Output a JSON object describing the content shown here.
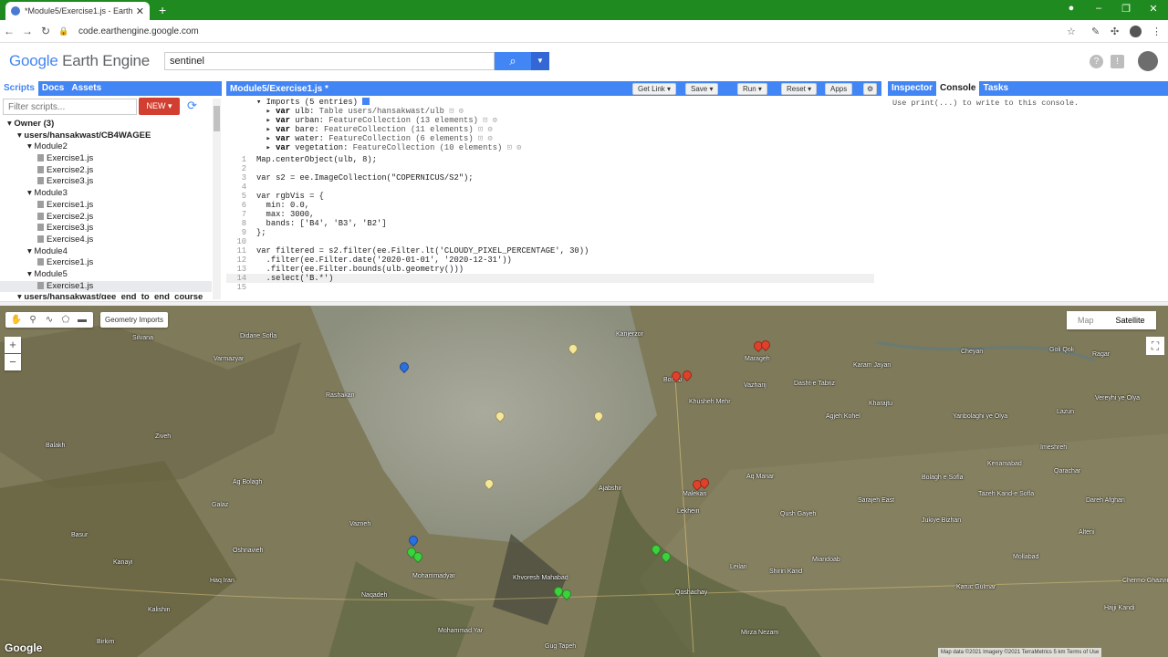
{
  "browser": {
    "tab_title": "*Module5/Exercise1.js - Earth Engi",
    "url": "code.earthengine.google.com"
  },
  "header": {
    "logo_google": "Google",
    "logo_product": "Earth Engine",
    "search_value": "sentinel"
  },
  "left_panel": {
    "tabs": [
      "Scripts",
      "Docs",
      "Assets"
    ],
    "filter_placeholder": "Filter scripts...",
    "new_label": "NEW",
    "tree": [
      {
        "label": "Owner (3)",
        "depth": 0,
        "type": "folder"
      },
      {
        "label": "users/hansakwast/CB4WAGEE",
        "depth": 1,
        "type": "folder"
      },
      {
        "label": "Module2",
        "depth": 2,
        "type": "folder"
      },
      {
        "label": "Exercise1.js",
        "depth": 3,
        "type": "file"
      },
      {
        "label": "Exercise2.js",
        "depth": 3,
        "type": "file"
      },
      {
        "label": "Exercise3.js",
        "depth": 3,
        "type": "file"
      },
      {
        "label": "Module3",
        "depth": 2,
        "type": "folder"
      },
      {
        "label": "Exercise1.js",
        "depth": 3,
        "type": "file"
      },
      {
        "label": "Exercise2.js",
        "depth": 3,
        "type": "file"
      },
      {
        "label": "Exercise3.js",
        "depth": 3,
        "type": "file"
      },
      {
        "label": "Exercise4.js",
        "depth": 3,
        "type": "file"
      },
      {
        "label": "Module4",
        "depth": 2,
        "type": "folder"
      },
      {
        "label": "Exercise1.js",
        "depth": 3,
        "type": "file"
      },
      {
        "label": "Module5",
        "depth": 2,
        "type": "folder"
      },
      {
        "label": "Exercise1.js",
        "depth": 3,
        "type": "file",
        "selected": true
      },
      {
        "label": "users/hansakwast/gee_end_to_end_course",
        "depth": 1,
        "type": "folder"
      }
    ]
  },
  "editor": {
    "title": "Module5/Exercise1.js *",
    "buttons": [
      "Get Link",
      "Save",
      "Run",
      "Reset",
      "Apps"
    ],
    "imports_header": "Imports (5 entries)",
    "imports": [
      {
        "var": "ulb",
        "value": "Table users/hansakwast/ulb"
      },
      {
        "var": "urban",
        "value": "FeatureCollection (13 elements)"
      },
      {
        "var": "bare",
        "value": "FeatureCollection (11 elements)"
      },
      {
        "var": "water",
        "value": "FeatureCollection (6 elements)"
      },
      {
        "var": "vegetation",
        "value": "FeatureCollection (10 elements)"
      }
    ],
    "lines": [
      "Map.centerObject(ulb, 8);",
      "",
      "var s2 = ee.ImageCollection(\"COPERNICUS/S2\");",
      "",
      "var rgbVis = {",
      "  min: 0.0,",
      "  max: 3000,",
      "  bands: ['B4', 'B3', 'B2']",
      "};",
      "",
      "var filtered = s2.filter(ee.Filter.lt('CLOUDY_PIXEL_PERCENTAGE', 30))",
      "  .filter(ee.Filter.date('2020-01-01', '2020-12-31'))",
      "  .filter(ee.Filter.bounds(ulb.geometry()))",
      "  .select('B.*')",
      ""
    ]
  },
  "right_panel": {
    "tabs": [
      "Inspector",
      "Console",
      "Tasks"
    ],
    "active_tab": "Console",
    "console_hint": "Use print(...) to write to this console."
  },
  "map": {
    "geometry_imports": "Geometry Imports",
    "map_types": [
      "Map",
      "Satellite"
    ],
    "google_logo": "Google",
    "attribution": "Map data ©2021 Imagery ©2021 TerraMetrics   5 km   Terms of Use",
    "place_labels": [
      "Silvana",
      "Didane Sofla",
      "Varmazyar",
      "Rashakan",
      "Golmankhaneh",
      "Anzal-e Jonubi",
      "Kanjerzor",
      "Marageh",
      "Ziveh",
      "Balakh",
      "Ag Bolagh",
      "Galaz",
      "Vazneh",
      "Basur",
      "Kanayi",
      "Oshnavieh",
      "Haq Iran",
      "Kalishin",
      "Birkim",
      "Naqadeh",
      "Mohammadyar",
      "Mohammad Yar",
      "Khvoresh Mahabad",
      "Gug Tapeh",
      "Qoshachay",
      "Mirza Nezam",
      "Leilan",
      "Shirin Kand",
      "Miandoab",
      "Malekan",
      "Bonab",
      "Khusheh Mehr",
      "Vazharij",
      "Dasht-e Tabriz",
      "Ajabshir",
      "Karam Jayan",
      "Agjeh Kohel",
      "Yanbolaghi ye Olya",
      "Qush Gayeh",
      "Imeshreh",
      "Cheyan",
      "Aq Manar",
      "Sarajeh East",
      "Bolagh e Sofla",
      "Jukiye Bizhan",
      "Lekhein",
      "Tazeh Kand-e Sofla",
      "Mollabad",
      "Alteni",
      "Dareh Afghan",
      "Kenamabad",
      "Qarachar",
      "Lazun",
      "Goli Qoli",
      "Hajji Kandi",
      "Karuc Gulmar",
      "Chermo Ghazvineh",
      "Ragar",
      "Vereyhi ye Olya",
      "Kharajtu",
      "Tabriz"
    ]
  },
  "colors": {
    "chrome_green": "#1f8a1f",
    "gee_blue": "#4285f4",
    "new_red": "#d23f31",
    "pin_yellow": "#f5e79a",
    "pin_red": "#e0412a",
    "pin_green": "#3cd23c",
    "pin_blue": "#2b6fe0"
  }
}
